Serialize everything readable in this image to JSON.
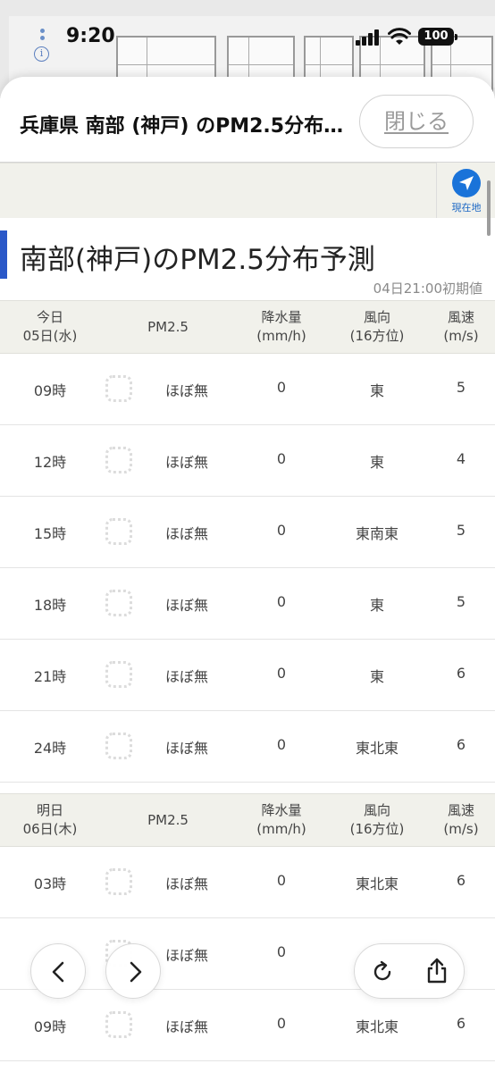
{
  "status": {
    "time": "9:20",
    "battery": "100"
  },
  "sheet": {
    "title": "兵庫県 南部 (神戸) のPM2.5分布予測",
    "close_label": "閉じる"
  },
  "locate": {
    "label": "現在地"
  },
  "heading": {
    "title": "南部(神戸)のPM2.5分布予測",
    "init_time": "04日21:00初期値"
  },
  "columns": {
    "pm": "PM2.5",
    "rain_1": "降水量",
    "rain_2": "(mm/h)",
    "dir_1": "風向",
    "dir_2": "(16方位)",
    "wind_1": "風速",
    "wind_2": "(m/s)"
  },
  "days": [
    {
      "label": "今日",
      "date": "05日(水)",
      "rows": [
        {
          "time": "09時",
          "level": "ほぼ無",
          "rain": "0",
          "dir": "東",
          "wind": "5"
        },
        {
          "time": "12時",
          "level": "ほぼ無",
          "rain": "0",
          "dir": "東",
          "wind": "4"
        },
        {
          "time": "15時",
          "level": "ほぼ無",
          "rain": "0",
          "dir": "東南東",
          "wind": "5"
        },
        {
          "time": "18時",
          "level": "ほぼ無",
          "rain": "0",
          "dir": "東",
          "wind": "5"
        },
        {
          "time": "21時",
          "level": "ほぼ無",
          "rain": "0",
          "dir": "東",
          "wind": "6"
        },
        {
          "time": "24時",
          "level": "ほぼ無",
          "rain": "0",
          "dir": "東北東",
          "wind": "6"
        }
      ]
    },
    {
      "label": "明日",
      "date": "06日(木)",
      "rows": [
        {
          "time": "03時",
          "level": "ほぼ無",
          "rain": "0",
          "dir": "東北東",
          "wind": "6"
        },
        {
          "time": "",
          "level": "ほぼ無",
          "rain": "0",
          "dir": "",
          "wind": ""
        },
        {
          "time": "09時",
          "level": "ほぼ無",
          "rain": "0",
          "dir": "東北東",
          "wind": "6"
        }
      ]
    }
  ]
}
